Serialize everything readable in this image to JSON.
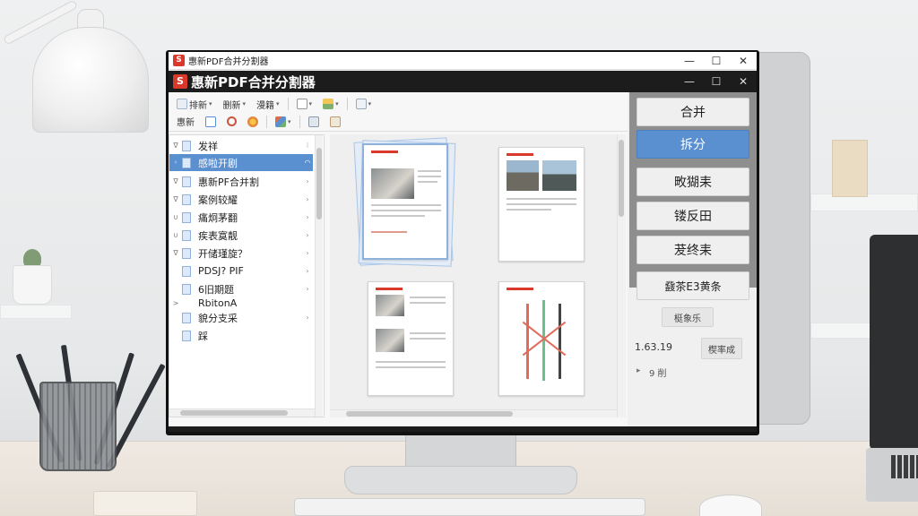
{
  "window": {
    "outer_title": "惠新PDF合并分割器",
    "inner_title": "惠新PDF合并分割器",
    "logo_glyph": "S"
  },
  "window_controls": {
    "minimize": "—",
    "maximize": "☐",
    "close": "✕"
  },
  "toolbar_row1": [
    {
      "label": "排新",
      "icon": "file-icon"
    },
    {
      "label": "删新",
      "icon": ""
    },
    {
      "label": "漫籍",
      "icon": ""
    },
    {
      "label": "",
      "icon": "page-icon"
    },
    {
      "label": "",
      "icon": "layers-icon"
    },
    {
      "label": "",
      "icon": "document-icon"
    }
  ],
  "toolbar_row2": [
    {
      "label": "惠新",
      "icon": ""
    },
    {
      "label": "",
      "icon": "page-icon"
    },
    {
      "label": "",
      "icon": "rotate-icon"
    },
    {
      "label": "",
      "icon": "color-icon"
    },
    {
      "label": "",
      "icon": "shapes-icon"
    },
    {
      "label": "",
      "icon": "export-icon"
    },
    {
      "label": "",
      "icon": "merge-icon"
    }
  ],
  "tree_items": [
    {
      "label": "发祥",
      "mark": "⁝",
      "selected": false
    },
    {
      "label": "感啦开剧",
      "mark": "◠",
      "selected": true
    },
    {
      "label": "惠新PF合并割",
      "mark": "›",
      "selected": false
    },
    {
      "label": "案例较耀",
      "mark": "›",
      "selected": false
    },
    {
      "label": "痛炯茅翻",
      "mark": "›",
      "selected": false
    },
    {
      "label": "疾表寞靓",
      "mark": "›",
      "selected": false
    },
    {
      "label": "开储瑾旋？",
      "mark": "›",
      "selected": false
    },
    {
      "label": "PDSJ? PIF",
      "mark": "›",
      "selected": false
    },
    {
      "label": "6旧期题",
      "mark": "›",
      "selected": false
    },
    {
      "label": "RbitonA",
      "mark": "",
      "selected": false
    },
    {
      "label": "貌分支采",
      "mark": "›",
      "selected": false
    },
    {
      "label": "踩",
      "mark": "",
      "selected": false
    }
  ],
  "right_panel": {
    "buttons": [
      {
        "label": "合并",
        "active": false
      },
      {
        "label": "拆分",
        "active": true
      },
      {
        "label": "畋猢耒",
        "active": false
      },
      {
        "label": "镂反田",
        "active": false
      },
      {
        "label": "茇终耒",
        "active": false
      },
      {
        "label": "鼗茶E3黄条",
        "active": false
      }
    ],
    "secondary_button": "梃象乐",
    "version": "1.63.19",
    "version_button": "楔率成",
    "expander": "9 削",
    "expander_arrow": "▸"
  },
  "colors": {
    "accent": "#5a8fd0",
    "brand_red": "#d9382b",
    "title_bar": "#1c1c1c"
  }
}
